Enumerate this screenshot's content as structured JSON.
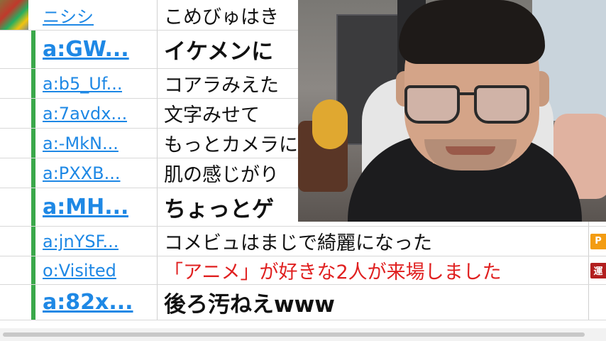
{
  "comments": [
    {
      "user": "ニシシ",
      "message": "こめびゅはき",
      "style": "small",
      "tag": ""
    },
    {
      "user": "a:GW...",
      "message": "イケメンに",
      "style": "big",
      "tag": ""
    },
    {
      "user": "a:b5_Uf...",
      "message": "コアラみえた",
      "style": "small",
      "tag": ""
    },
    {
      "user": "a:7avdx...",
      "message": "文字みせて",
      "style": "small",
      "tag": ""
    },
    {
      "user": "a:-MkN...",
      "message": "もっとカメラに",
      "style": "small",
      "tag": ""
    },
    {
      "user": "a:PXXB...",
      "message": "肌の感じがり",
      "style": "small",
      "tag": ""
    },
    {
      "user": "a:MH...",
      "message": "ちょっとゲ",
      "style": "big",
      "tag": ""
    },
    {
      "user": "a:jnYSF...",
      "message": "コメビュはまじで綺麗になった",
      "style": "small",
      "tag": "P"
    },
    {
      "user": "o:Visited",
      "message": "「アニメ」が好きな2人が来場しました",
      "style": "small",
      "red": true,
      "tag": "運"
    },
    {
      "user": "a:82x...",
      "message": "後ろ汚ねえwww",
      "style": "big",
      "tag": ""
    }
  ],
  "colors": {
    "link": "#1e88e5",
    "accent_bar": "#3aa84a",
    "system_message": "#e02020",
    "tag_premium": "#f39c12",
    "tag_operator": "#b21f1f"
  },
  "webcam": {
    "icon": "webcam-overlay"
  }
}
